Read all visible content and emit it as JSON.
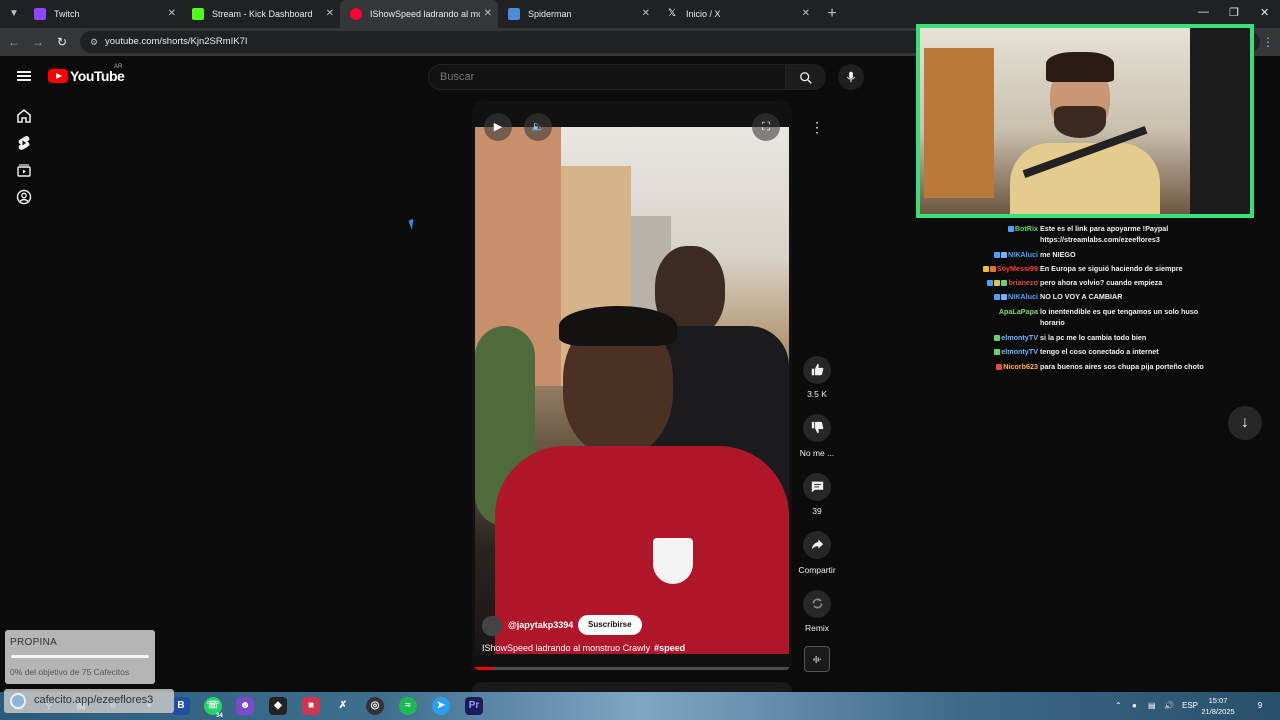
{
  "browser": {
    "tabs": [
      {
        "title": "Twitch",
        "favicon_color": "#9146ff",
        "active": false
      },
      {
        "title": "Stream - Kick Dashboard",
        "favicon_color": "#53fc18",
        "active": false
      },
      {
        "title": "IShowSpeed ladrando al monstruo",
        "favicon_color": "#ff0033",
        "active": true
      },
      {
        "title": "Spiderman",
        "favicon_color": "#4a8cd8",
        "active": false
      },
      {
        "title": "Inicio / X",
        "favicon_color": "#ffffff",
        "active": false
      }
    ],
    "url": "youtube.com/shorts/Kjn2SRmIK7I"
  },
  "youtube": {
    "logo_text": "YouTube",
    "country_code": "AR",
    "search_placeholder": "Buscar",
    "sidebar_icons": [
      "home-icon",
      "shorts-icon",
      "subscriptions-icon",
      "you-icon"
    ]
  },
  "short": {
    "channel": "@japytakp3394",
    "subscribe_label": "Suscribirse",
    "caption": "IShowSpeed ladrando al monstruo Crawly",
    "hashtag": "#speed",
    "progress": 0.06,
    "actions": {
      "likes": "3.5 K",
      "dislike_label": "No me ...",
      "comments": "39",
      "share_label": "Compartir",
      "remix_label": "Remix"
    }
  },
  "chat": [
    {
      "user": "BotRix",
      "color": "#63d36b",
      "message": "Este es el link para apoyarme !Paypal https://streamlabs.com/ezeeflores3"
    },
    {
      "user": "NIKAluci",
      "color": "#4aa3ff",
      "message": "me NIEGO"
    },
    {
      "user": "SoyMessi99",
      "color": "#ff3b3b",
      "message": "En Europa se siguió haciendo de siempre"
    },
    {
      "user": "brianezo",
      "color": "#e04a4a",
      "message": "pero ahora volvio? cuando empieza"
    },
    {
      "user": "NIKAluci",
      "color": "#4aa3ff",
      "message": "NO LO VOY A CAMBIAR"
    },
    {
      "user": "ApaLaPapa",
      "color": "#8bd46e",
      "message": "lo inentendible es que tengamos un solo huso horario"
    },
    {
      "user": "elmontyTV",
      "color": "#6fb4ff",
      "message": "si la pc me lo cambia todo bien"
    },
    {
      "user": "elmontyTV",
      "color": "#6fb4ff",
      "message": "tengo el coso conectado a internet"
    },
    {
      "user": "Nicorb623",
      "color": "#ffb640",
      "message": "para buenos aires sos chupa pija porteño choto"
    }
  ],
  "tip_widget": {
    "title": "PROPINA",
    "goal_text": "0% del objetivo de 75 Cafecitos",
    "progress": 0.0,
    "link": "cafecito.app/ezeeflores3"
  },
  "taskbar": {
    "badge_count": "34",
    "language": "ESP",
    "time": "15:07",
    "date": "21/8/2025",
    "notification_count": "9"
  }
}
